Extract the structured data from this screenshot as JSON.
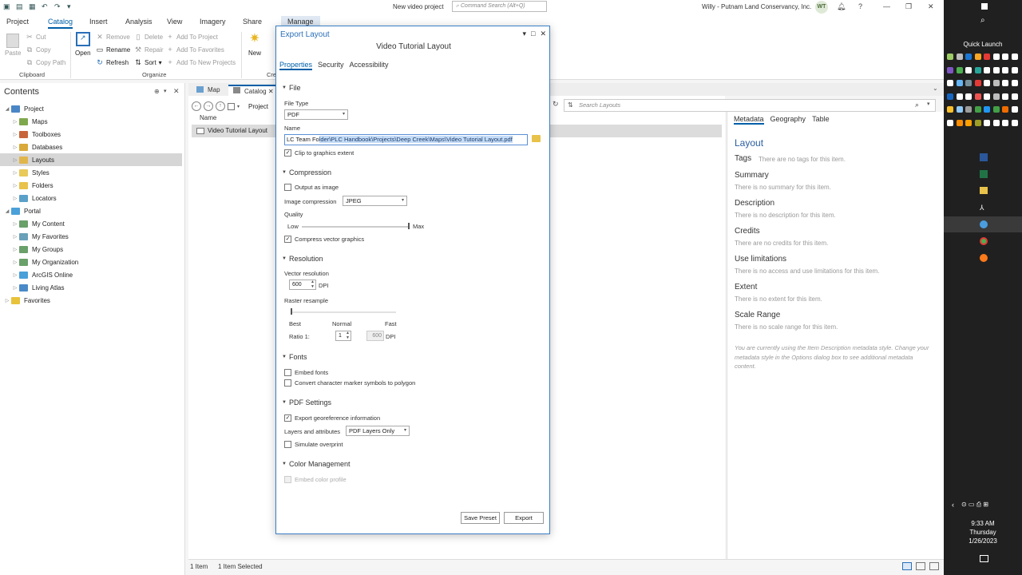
{
  "titlebar": {
    "doc_title": "New video project",
    "search_placeholder": "Command Search (Alt+Q)",
    "user": "Willy - Putnam Land Conservancy, Inc.",
    "avatar": "WT"
  },
  "ribbon": {
    "tabs": [
      "Project",
      "Catalog",
      "Insert",
      "Analysis",
      "View",
      "Imagery",
      "Share",
      "Manage"
    ],
    "clipboard": {
      "paste": "Paste",
      "cut": "Cut",
      "copy": "Copy",
      "copy_path": "Copy Path",
      "group": "Clipboard"
    },
    "organize": {
      "open": "Open",
      "remove": "Remove",
      "rename": "Rename",
      "refresh": "Refresh",
      "delete": "Delete",
      "repair": "Repair",
      "sort": "Sort",
      "add_to_project": "Add To Project",
      "add_to_favorites": "Add To Favorites",
      "add_to_new_projects": "Add To New Projects",
      "group": "Organize"
    },
    "create": {
      "new": "New",
      "group": "Cre"
    }
  },
  "contents": {
    "title": "Contents",
    "tree": [
      {
        "label": "Project",
        "color": "#4a86c5"
      },
      {
        "label": "Maps",
        "color": "#7fa84d"
      },
      {
        "label": "Toolboxes",
        "color": "#c8643a"
      },
      {
        "label": "Databases",
        "color": "#d9a93a"
      },
      {
        "label": "Layouts",
        "color": "#e0b64c"
      },
      {
        "label": "Styles",
        "color": "#e8c95a"
      },
      {
        "label": "Folders",
        "color": "#e8c24a"
      },
      {
        "label": "Locators",
        "color": "#5aa0c8"
      },
      {
        "label": "Portal",
        "color": "#4aa0d8"
      },
      {
        "label": "My Content",
        "color": "#6aa06a"
      },
      {
        "label": "My Favorites",
        "color": "#6aa0b8"
      },
      {
        "label": "My Groups",
        "color": "#6aa06a"
      },
      {
        "label": "My Organization",
        "color": "#6aa06a"
      },
      {
        "label": "ArcGIS Online",
        "color": "#4aa0d8"
      },
      {
        "label": "Living Atlas",
        "color": "#4a8ac8"
      },
      {
        "label": "Favorites",
        "color": "#e8c23a"
      }
    ]
  },
  "doctabs": {
    "map": "Map",
    "catalog": "Catalog"
  },
  "catalog": {
    "breadcrumb": "Project",
    "column_name": "Name",
    "item": "Video Tutorial Layout",
    "search_placeholder": "Search Layouts"
  },
  "metadata": {
    "tabs": [
      "Metadata",
      "Geography",
      "Table"
    ],
    "title": "Layout",
    "tags_label": "Tags",
    "tags_value": "There are no tags for this item.",
    "sections": [
      {
        "head": "Summary",
        "text": "There is no summary for this item."
      },
      {
        "head": "Description",
        "text": "There is no description for this item."
      },
      {
        "head": "Credits",
        "text": "There are no credits for this item."
      },
      {
        "head": "Use limitations",
        "text": "There is no access and use limitations for this item."
      },
      {
        "head": "Extent",
        "text": "There is no extent for this item."
      },
      {
        "head": "Scale Range",
        "text": "There is no scale range for this item."
      }
    ],
    "note": "You are currently using the Item Description metadata style. Change your metadata style in the Options dialog box to see additional metadata content."
  },
  "status": {
    "items": "1 Item",
    "selected": "1 Item Selected"
  },
  "dialog": {
    "title": "Export Layout",
    "subtitle": "Video Tutorial Layout",
    "tabs": [
      "Properties",
      "Security",
      "Accessibility"
    ],
    "file_section": "File",
    "file_type_label": "File Type",
    "file_type": "PDF",
    "name_label": "Name",
    "name_plain": "LC Team Fo",
    "name_selected": "lder\\PLC Handbook\\Projects\\Deep Creek\\Maps\\Video Tutorial Layout.pdf",
    "clip_label": "Clip to graphics extent",
    "compression_section": "Compression",
    "output_image_label": "Output as image",
    "image_comp_label": "Image compression",
    "image_comp": "JPEG",
    "quality_label": "Quality",
    "low": "Low",
    "max": "Max",
    "quality_fraction": 1.0,
    "compress_vector_label": "Compress vector graphics",
    "resolution_section": "Resolution",
    "vector_res_label": "Vector resolution",
    "vector_res": "600",
    "dpi": "DPI",
    "raster_label": "Raster resample",
    "best": "Best",
    "normal": "Normal",
    "fast": "Fast",
    "ratio_label": "Ratio 1:",
    "ratio": "1",
    "ratio_dpi": "600",
    "fonts_section": "Fonts",
    "embed_fonts_label": "Embed fonts",
    "convert_marker_label": "Convert character marker symbols to polygon",
    "pdf_section": "PDF Settings",
    "georef_label": "Export georeference information",
    "layers_label": "Layers and attributes",
    "layers_value": "PDF Layers Only",
    "overprint_label": "Simulate overprint",
    "color_section": "Color Management",
    "embed_color_label": "Embed color profile",
    "save_preset": "Save Preset",
    "export": "Export"
  },
  "taskbar": {
    "quick_launch": "Quick Launch",
    "time": "9:33 AM",
    "day": "Thursday",
    "date": "1/26/2023"
  }
}
